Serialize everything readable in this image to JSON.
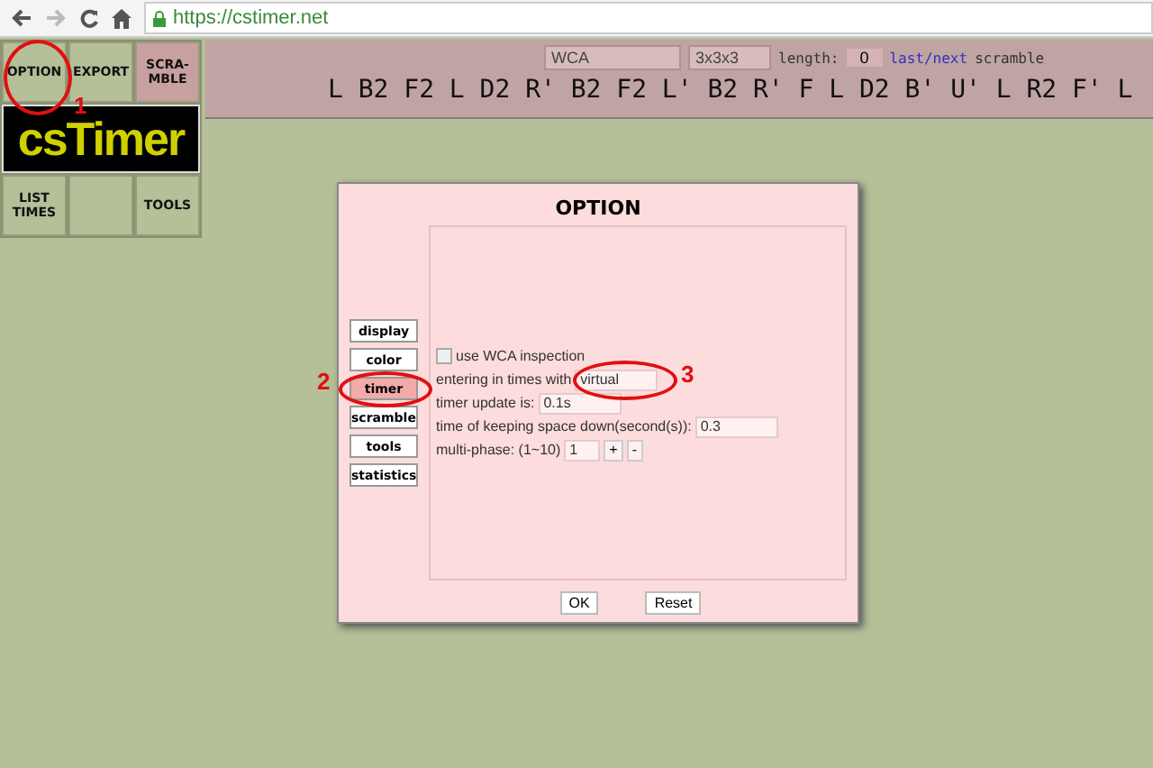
{
  "browser": {
    "url": "https://cstimer.net"
  },
  "menu": {
    "top": [
      {
        "lines": [
          "OPTION"
        ],
        "selected": false
      },
      {
        "lines": [
          "EXPORT"
        ],
        "selected": false
      },
      {
        "lines": [
          "SCRA-",
          "MBLE"
        ],
        "selected": true
      }
    ],
    "logo": "csTimer",
    "bottom": [
      {
        "lines": [
          "LIST",
          "TIMES"
        ],
        "selected": false
      },
      {
        "selected": false
      },
      {
        "lines": [
          "TOOLS"
        ],
        "selected": false
      }
    ]
  },
  "scramble_bar": {
    "type": "WCA",
    "puzzle": "3x3x3",
    "length_label": "length:",
    "length": "0",
    "link": "last/next",
    "link_suffix": "scramble",
    "scramble": "L B2 F2 L D2 R' B2 F2 L' B2 R' F L D2 B' U' L R2 F' L"
  },
  "dialog": {
    "title": "OPTION",
    "tabs": [
      {
        "label": "display",
        "selected": false
      },
      {
        "label": "color",
        "selected": false
      },
      {
        "label": "timer",
        "selected": true
      },
      {
        "label": "scramble",
        "selected": false
      },
      {
        "label": "tools",
        "selected": false
      },
      {
        "label": "statistics",
        "selected": false
      }
    ],
    "options": [
      {
        "kind": "checkbox",
        "label": "use WCA inspection",
        "checked": false
      },
      {
        "kind": "field",
        "label": "entering in times with",
        "value": "virtual"
      },
      {
        "kind": "field",
        "label": "timer update is:",
        "value": "0.1s"
      },
      {
        "kind": "field",
        "label": "time of keeping space down(second(s)):",
        "value": "0.3"
      },
      {
        "kind": "stepper",
        "label": "multi-phase: (1~10)",
        "value": "1",
        "buttons": [
          "+",
          "-"
        ]
      }
    ],
    "buttons": [
      "OK",
      "Reset"
    ]
  },
  "annotations": [
    {
      "number": "1"
    },
    {
      "number": "2"
    },
    {
      "number": "3"
    }
  ]
}
